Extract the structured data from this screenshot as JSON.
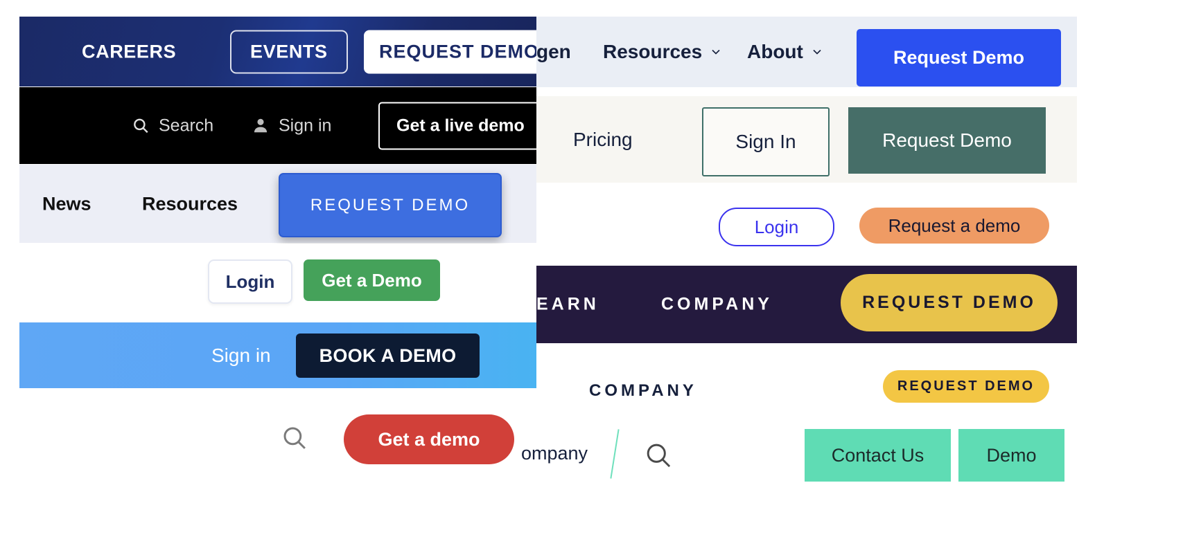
{
  "collage": {
    "title": "Website navigation CTA button examples",
    "panels": {
      "navy_bar": {
        "careers_label": "CAREERS",
        "events_label": "EVENTS",
        "request_demo_label": "REQUEST  DEMO",
        "bg_color": "#1b2a66"
      },
      "black_bar": {
        "search_label": "Search",
        "signin_label": "Sign in",
        "cta_label": "Get a live demo",
        "bg_color": "#000000"
      },
      "lavender_bar": {
        "news_label": "News",
        "resources_label": "Resources",
        "cta_label": "REQUEST DEMO",
        "bg_color": "#eceef6",
        "cta_color": "#3d6ee0"
      },
      "login_demo": {
        "login_label": "Login",
        "demo_label": "Get a Demo",
        "demo_color": "#45a25a"
      },
      "light_blue_bar": {
        "signin_label": "Sign in",
        "cta_label": "BOOK A DEMO",
        "bg_color": "#5aa6f6",
        "cta_color": "#0d1b33"
      },
      "red_demo": {
        "cta_label": "Get a demo",
        "cta_color": "#d14039"
      },
      "pale_lavender_nav": {
        "item_gen": "gen",
        "item_resources": "Resources",
        "item_about": "About",
        "cta_label": "Request Demo",
        "bg_color": "#eaeef5",
        "cta_color": "#2b50f0"
      },
      "offwhite_nav": {
        "pricing_label": "Pricing",
        "signin_label": "Sign In",
        "cta_label": "Request Demo",
        "bg_color": "#f7f6f2",
        "cta_color": "#466e68"
      },
      "orange_nav": {
        "login_label": "Login",
        "cta_label": "Request a demo",
        "login_border_color": "#3a32ee",
        "cta_color": "#ef9b64"
      },
      "plum_bar": {
        "item_learn": "EARN",
        "item_company": "COMPANY",
        "cta_label": "REQUEST DEMO",
        "bg_color": "#241a3e",
        "cta_color": "#e8c34b"
      },
      "company_row": {
        "company_label": "COMPANY",
        "cta_label": "REQUEST DEMO",
        "cta_color": "#f3c644"
      },
      "teal_row": {
        "contact_label": "Contact Us",
        "demo_label": "Demo",
        "btn_color": "#5fdcb4"
      },
      "bottom_fragment": {
        "company_fragment": "ompany"
      }
    }
  }
}
